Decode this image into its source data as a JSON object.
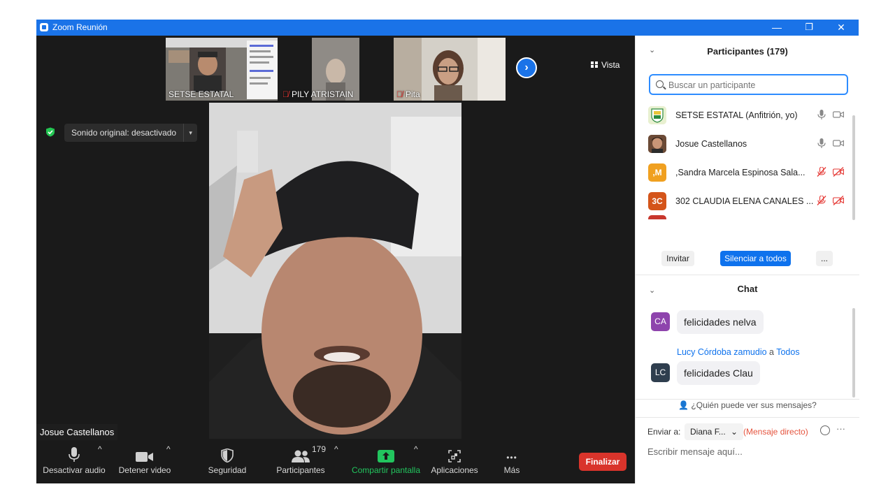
{
  "window": {
    "title": "Zoom Reunión",
    "minimize": "—",
    "restore": "❐",
    "close": "✕"
  },
  "gallery": {
    "tiles": [
      {
        "name": "SETSE ESTATAL",
        "muted": false
      },
      {
        "name": "PILY ATRISTAIN",
        "muted": true
      },
      {
        "name": "Pita",
        "muted": true
      }
    ],
    "next_symbol": "›",
    "view_label": "Vista"
  },
  "sound": {
    "label": "Sonido original: desactivado",
    "caret": "▾"
  },
  "speaker": {
    "name": "Josue Castellanos"
  },
  "toolbar": {
    "audio_label": "Desactivar audio",
    "video_label": "Detener video",
    "security_label": "Seguridad",
    "participants_label": "Participantes",
    "participants_count": "179",
    "share_label": "Compartir pantalla",
    "apps_label": "Aplicaciones",
    "more_label": "Más",
    "end_label": "Finalizar",
    "chevron": "^",
    "more_dots": "•••"
  },
  "colors": {
    "accent": "#0e72ed",
    "titlebar": "#1a73e8",
    "end": "#d9342b",
    "share": "#22c55e",
    "muted": "#e53935"
  },
  "participants_panel": {
    "title": "Participantes (179)",
    "collapse": "⌄",
    "search_placeholder": "Buscar un participante",
    "rows": [
      {
        "name": "SETSE ESTATAL (Anfitrión, yo)",
        "avatar_text": "",
        "avatar_color": "#e8e2a0",
        "muted": false
      },
      {
        "name": "Josue Castellanos",
        "avatar_text": "",
        "avatar_color": "#8a5a3c",
        "muted": false
      },
      {
        "name": ",Sandra Marcela Espinosa Sala...",
        "avatar_text": ",M",
        "avatar_color": "#f0a020",
        "muted": true
      },
      {
        "name": "302 CLAUDIA ELENA CANALES ...",
        "avatar_text": "3C",
        "avatar_color": "#d4541a",
        "muted": true
      }
    ],
    "invite_label": "Invitar",
    "mute_all_label": "Silenciar a todos",
    "more_label": "..."
  },
  "chat": {
    "title": "Chat",
    "collapse": "⌄",
    "messages": [
      {
        "avatar": "CA",
        "avatar_color": "#8e44ad",
        "text": "felicidades nelva"
      },
      {
        "avatar": "LC",
        "avatar_color": "#2f3e4e",
        "text": "felicidades Clau",
        "sender": "Lucy Córdoba zamudio",
        "connector": "a",
        "recipient": "Todos"
      }
    ],
    "who_can_see": "¿Quién puede ver sus mensajes?",
    "send_to_label": "Enviar a:",
    "recipient_select": "Diana F...",
    "select_caret": "⌄",
    "direct_label": "(Mensaje directo)",
    "more_dots": "···",
    "input_placeholder": "Escribir mensaje aquí..."
  }
}
